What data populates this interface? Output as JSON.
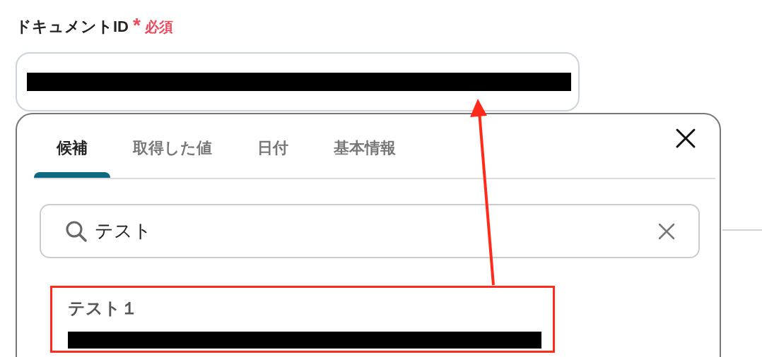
{
  "field": {
    "label": "ドキュメントID",
    "required_mark": "*",
    "required_text": "必須"
  },
  "popup": {
    "tabs": [
      {
        "label": "候補",
        "selected": true
      },
      {
        "label": "取得した値",
        "selected": false
      },
      {
        "label": "日付",
        "selected": false
      },
      {
        "label": "基本情報",
        "selected": false
      }
    ],
    "search": {
      "value": "テスト"
    },
    "results": [
      {
        "title": "テスト１",
        "highlighted": true
      }
    ]
  }
}
